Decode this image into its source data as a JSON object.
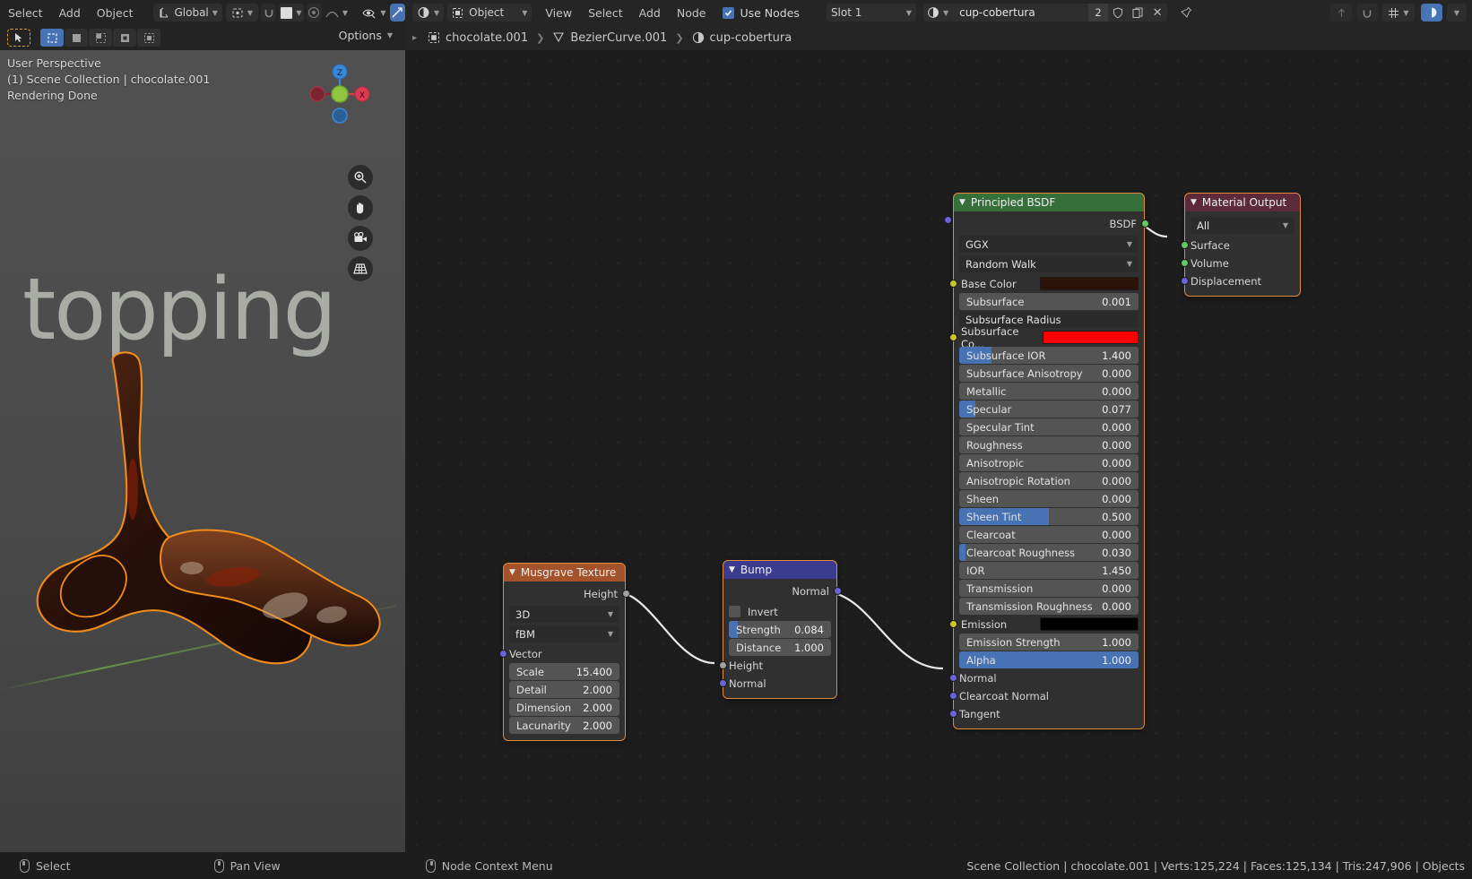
{
  "topbar": {
    "menus": [
      "Select",
      "Add",
      "Object"
    ],
    "transform_orientation": "Global",
    "snap_icon": "magnet-icon",
    "proportional_icon": "proportional-editing-icon",
    "falloff_icon": "smooth-falloff-icon",
    "visibility_icon": "eye-icon",
    "overlay_icon": "overlays-icon",
    "right_icons": [
      "arrow-up-icon",
      "magnet-icon",
      "snap-grid-icon",
      "globe-icon"
    ]
  },
  "node_header": {
    "editor_icon": "shading-editor-icon",
    "shader_type": "Object",
    "menus": [
      "View",
      "Select",
      "Add",
      "Node"
    ],
    "use_nodes_label": "Use Nodes",
    "use_nodes_checked": true,
    "slot": "Slot 1",
    "material_icon": "material-sphere-icon",
    "material_name": "cup-cobertura",
    "users_count": "2",
    "shield_icon": "fake-user-shield-icon",
    "copy_icon": "new-material-icon",
    "close_icon": "unlink-x-icon",
    "pin_icon": "pin-icon"
  },
  "toolrow": {
    "buttons": [
      "tweak-tool-icon",
      "select-box-icon",
      "select-circle-icon",
      "select-lasso-icon",
      "select-extend-icon",
      "select-subtract-icon"
    ],
    "options_label": "Options"
  },
  "breadcrumb": {
    "items": [
      {
        "icon": "object-icon",
        "label": "chocolate.001"
      },
      {
        "icon": "curve-data-icon",
        "label": "BezierCurve.001"
      },
      {
        "icon": "material-sphere-icon",
        "label": "cup-cobertura"
      }
    ],
    "separator": ">"
  },
  "viewport": {
    "perspective": "User Perspective",
    "collection_line": "(1) Scene Collection | chocolate.001",
    "render_status": "Rendering Done",
    "overlay_title": "topping",
    "gizmo_axes": [
      "Z",
      "X"
    ],
    "tools": [
      "zoom-icon",
      "pan-hand-icon",
      "camera-icon",
      "perspective-toggle-icon"
    ],
    "colors": {
      "x_axis": "#dd3b50",
      "y_axis": "#8ec63f",
      "z_axis": "#3a86d8",
      "bg": "#4b4b4b"
    }
  },
  "nodes": {
    "musgrave": {
      "title": "Musgrave Texture",
      "header_color": "#a4522a",
      "outputs": [
        {
          "label": "Height",
          "socket": "grey"
        }
      ],
      "dropdowns": [
        "3D",
        "fBM"
      ],
      "inputs": [
        {
          "label": "Vector",
          "socket": "purple"
        }
      ],
      "props": [
        {
          "label": "Scale",
          "value": "15.400",
          "fill": 0
        },
        {
          "label": "Detail",
          "value": "2.000",
          "fill": 0
        },
        {
          "label": "Dimension",
          "value": "2.000",
          "fill": 0
        },
        {
          "label": "Lacunarity",
          "value": "2.000",
          "fill": 0
        }
      ]
    },
    "bump": {
      "title": "Bump",
      "header_color": "#3b3b8f",
      "outputs": [
        {
          "label": "Normal",
          "socket": "purple"
        }
      ],
      "checkbox": {
        "label": "Invert",
        "checked": false
      },
      "props": [
        {
          "label": "Strength",
          "value": "0.084",
          "fill": 9
        },
        {
          "label": "Distance",
          "value": "1.000",
          "fill": 0
        }
      ],
      "inputs": [
        {
          "label": "Height",
          "socket": "grey"
        },
        {
          "label": "Normal",
          "socket": "purple"
        }
      ]
    },
    "principled": {
      "title": "Principled BSDF",
      "header_color": "#35703a",
      "outputs": [
        {
          "label": "BSDF",
          "socket": "green"
        }
      ],
      "dropdowns": [
        "GGX",
        "Random Walk"
      ],
      "rows": [
        {
          "type": "color",
          "label": "Base Color",
          "socket": "yellow",
          "color": "#2c1208"
        },
        {
          "type": "prop",
          "label": "Subsurface",
          "value": "0.001",
          "socket": "grey",
          "fill": 0
        },
        {
          "type": "dropdown_socket",
          "label": "Subsurface Radius",
          "socket": "purple"
        },
        {
          "type": "color",
          "label": "Subsurface Co...",
          "socket": "yellow",
          "color": "#fc0000"
        },
        {
          "type": "prop",
          "label": "Subsurface IOR",
          "value": "1.400",
          "socket": "grey",
          "fill": 18
        },
        {
          "type": "prop",
          "label": "Subsurface Anisotropy",
          "value": "0.000",
          "socket": "grey",
          "fill": 0
        },
        {
          "type": "prop",
          "label": "Metallic",
          "value": "0.000",
          "socket": "grey",
          "fill": 0
        },
        {
          "type": "prop",
          "label": "Specular",
          "value": "0.077",
          "socket": "grey",
          "fill": 9
        },
        {
          "type": "prop",
          "label": "Specular Tint",
          "value": "0.000",
          "socket": "grey",
          "fill": 0
        },
        {
          "type": "prop",
          "label": "Roughness",
          "value": "0.000",
          "socket": "grey",
          "fill": 0
        },
        {
          "type": "prop",
          "label": "Anisotropic",
          "value": "0.000",
          "socket": "grey",
          "fill": 0
        },
        {
          "type": "prop",
          "label": "Anisotropic Rotation",
          "value": "0.000",
          "socket": "grey",
          "fill": 0
        },
        {
          "type": "prop",
          "label": "Sheen",
          "value": "0.000",
          "socket": "grey",
          "fill": 0
        },
        {
          "type": "prop",
          "label": "Sheen Tint",
          "value": "0.500",
          "socket": "grey",
          "fill": 50
        },
        {
          "type": "prop",
          "label": "Clearcoat",
          "value": "0.000",
          "socket": "grey",
          "fill": 0
        },
        {
          "type": "prop",
          "label": "Clearcoat Roughness",
          "value": "0.030",
          "socket": "grey",
          "fill": 3.5
        },
        {
          "type": "prop",
          "label": "IOR",
          "value": "1.450",
          "socket": "grey",
          "fill": 0
        },
        {
          "type": "prop",
          "label": "Transmission",
          "value": "0.000",
          "socket": "grey",
          "fill": 0
        },
        {
          "type": "prop",
          "label": "Transmission Roughness",
          "value": "0.000",
          "socket": "grey",
          "fill": 0
        },
        {
          "type": "color",
          "label": "Emission",
          "socket": "yellow",
          "color": "#000000"
        },
        {
          "type": "prop",
          "label": "Emission Strength",
          "value": "1.000",
          "socket": "grey",
          "fill": 0
        },
        {
          "type": "prop",
          "label": "Alpha",
          "value": "1.000",
          "socket": "grey",
          "fill": 100
        },
        {
          "type": "socket",
          "label": "Normal",
          "socket": "purple"
        },
        {
          "type": "socket",
          "label": "Clearcoat Normal",
          "socket": "purple"
        },
        {
          "type": "socket",
          "label": "Tangent",
          "socket": "purple"
        }
      ]
    },
    "material_output": {
      "title": "Material Output",
      "header_color": "#5c2a3a",
      "dropdown": "All",
      "inputs": [
        {
          "label": "Surface",
          "socket": "green"
        },
        {
          "label": "Volume",
          "socket": "green"
        },
        {
          "label": "Displacement",
          "socket": "purple"
        }
      ]
    }
  },
  "statusbar": {
    "items": [
      {
        "mouse": "left",
        "label": "Select"
      },
      {
        "mouse": "middle",
        "label": "Pan View"
      },
      {
        "mouse": "right",
        "label": "Node Context Menu"
      }
    ],
    "scene_stats": "Scene Collection | chocolate.001 | Verts:125,224 | Faces:125,134 | Tris:247,906 | Objects"
  }
}
